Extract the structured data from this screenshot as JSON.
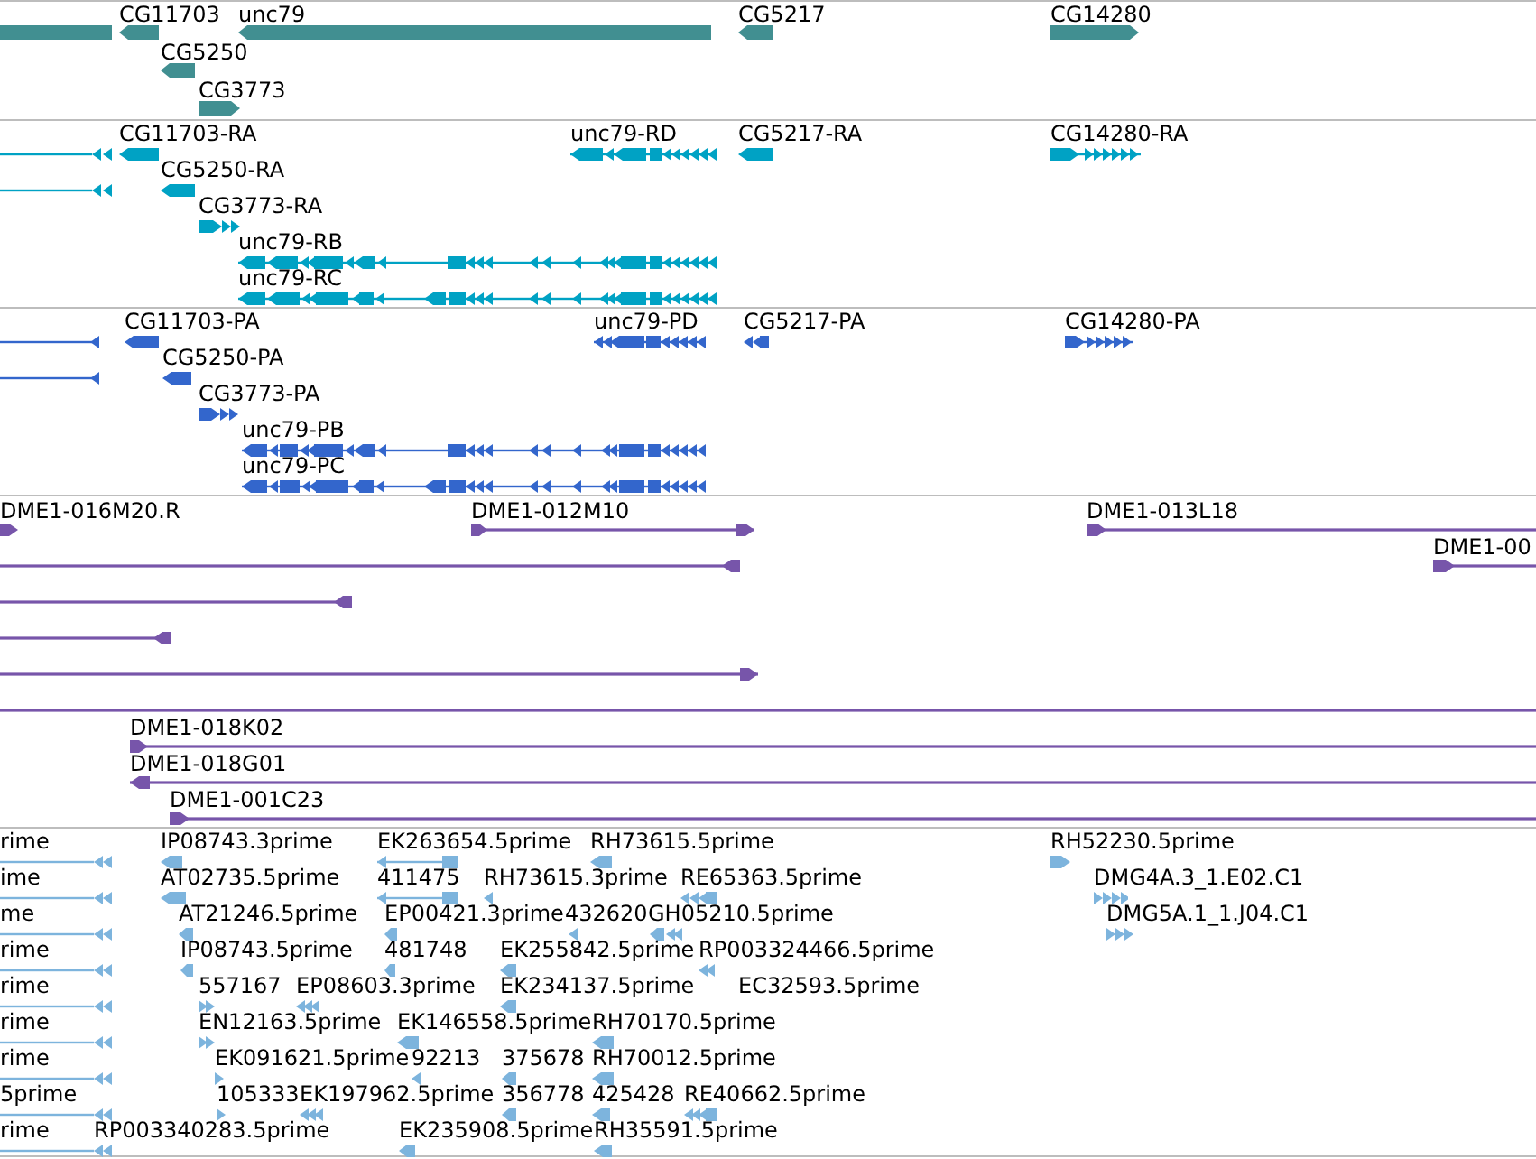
{
  "tracks": [
    {
      "kind": "gene",
      "features": [
        {
          "reverse": true
        },
        {
          "label": "CG11703",
          "reverse": true
        },
        {
          "label": "unc79",
          "reverse": true
        },
        {
          "label": "CG5217",
          "reverse": true
        },
        {
          "label": "CG14280",
          "reverse": false
        },
        {
          "label": "CG5250",
          "reverse": true
        },
        {
          "label": "CG3773",
          "reverse": false
        }
      ]
    },
    {
      "kind": "transcript",
      "features": [
        {
          "reverse": true
        },
        {
          "label": "CG11703-RA",
          "reverse": true
        },
        {
          "label": "unc79-RD",
          "reverse": true
        },
        {
          "label": "CG5217-RA",
          "reverse": true
        },
        {
          "label": "CG14280-RA",
          "reverse": false
        },
        {
          "reverse": true
        },
        {
          "label": "CG5250-RA",
          "reverse": true
        },
        {
          "label": "CG3773-RA",
          "reverse": false
        },
        {
          "label": "unc79-RB",
          "reverse": true
        },
        {
          "label": "unc79-RC",
          "reverse": true
        }
      ]
    },
    {
      "kind": "protein",
      "features": [
        {
          "reverse": true
        },
        {
          "label": "CG11703-PA",
          "reverse": true
        },
        {
          "label": "unc79-PD",
          "reverse": true
        },
        {
          "label": "CG5217-PA",
          "reverse": true
        },
        {
          "label": "CG14280-PA",
          "reverse": false
        },
        {
          "reverse": true
        },
        {
          "label": "CG5250-PA",
          "reverse": true
        },
        {
          "label": "CG3773-PA",
          "reverse": false
        },
        {
          "label": "unc79-PB",
          "reverse": true
        },
        {
          "label": "unc79-PC",
          "reverse": true
        }
      ]
    },
    {
      "kind": "clone",
      "features": [
        {
          "kind": "capped",
          "label": "DME1-016M20.R",
          "reverse": false
        },
        {
          "kind": "capped",
          "label": "DME1-012M10",
          "reverse": false
        },
        {
          "kind": "capped",
          "label": "DME1-013L18",
          "reverse": false
        },
        {
          "kind": "capped",
          "reverse": true
        },
        {
          "kind": "capped",
          "label": "DME1-00",
          "reverse": false
        },
        {
          "kind": "capped",
          "reverse": true
        },
        {
          "kind": "capped",
          "reverse": true
        },
        {
          "kind": "capped",
          "reverse": false
        },
        {
          "kind": "spanning"
        },
        {
          "kind": "capped",
          "label": "DME1-018K02",
          "reverse": false
        },
        {
          "kind": "capped",
          "label": "DME1-018G01",
          "reverse": true
        },
        {
          "kind": "capped",
          "label": "DME1-001C23",
          "reverse": false
        }
      ]
    },
    {
      "kind": "est",
      "features": [
        {
          "label": "rime",
          "reverse": true
        },
        {
          "label": "IP08743.3prime",
          "reverse": true
        },
        {
          "label": "EK263654.5prime",
          "reverse": true
        },
        {
          "label": "RH73615.5prime",
          "reverse": true
        },
        {
          "label": "RH52230.5prime",
          "reverse": false
        },
        {
          "label": "ime",
          "reverse": true
        },
        {
          "label": "AT02735.5prime",
          "reverse": true
        },
        {
          "label": "411475",
          "reverse": true
        },
        {
          "label": "RH73615.3prime",
          "reverse": true
        },
        {
          "label": "RE65363.5prime",
          "reverse": true
        },
        {
          "label": "DMG4A.3_1.E02.C1",
          "reverse": false
        },
        {
          "label": "me",
          "reverse": true
        },
        {
          "label": "AT21246.5prime",
          "reverse": true
        },
        {
          "label": "EP00421.3prime",
          "reverse": true
        },
        {
          "label": "432620",
          "reverse": true
        },
        {
          "label": "GH05210.5prime",
          "reverse": true
        },
        {
          "label": "DMG5A.1_1.J04.C1",
          "reverse": false
        },
        {
          "label": "rime",
          "reverse": true
        },
        {
          "label": "IP08743.5prime",
          "reverse": true
        },
        {
          "label": "481748",
          "reverse": true
        },
        {
          "label": "EK255842.5prime",
          "reverse": true
        },
        {
          "label": "RP003324466.5prime",
          "reverse": true
        },
        {
          "label": "rime",
          "reverse": true
        },
        {
          "label": "557167",
          "reverse": false
        },
        {
          "label": "EP08603.3prime",
          "reverse": true
        },
        {
          "label": "EK234137.5prime",
          "reverse": true
        },
        {
          "label": "EC32593.5prime"
        },
        {
          "label": "rime",
          "reverse": true
        },
        {
          "label": "EN12163.5prime",
          "reverse": false
        },
        {
          "label": "EK146558.5prime",
          "reverse": true
        },
        {
          "label": "RH70170.5prime",
          "reverse": true
        },
        {
          "label": "rime",
          "reverse": true
        },
        {
          "label": "EK091621.5prime",
          "reverse": false
        },
        {
          "label": "92213",
          "reverse": true
        },
        {
          "label": "375678",
          "reverse": true
        },
        {
          "label": "RH70012.5prime",
          "reverse": true
        },
        {
          "label": "5prime",
          "reverse": true
        },
        {
          "label": "105333",
          "reverse": false
        },
        {
          "label": "EK197962.5prime",
          "reverse": true
        },
        {
          "label": "356778",
          "reverse": true
        },
        {
          "label": "425428",
          "reverse": true
        },
        {
          "label": "RE40662.5prime",
          "reverse": true
        },
        {
          "label": "rime",
          "reverse": true
        },
        {
          "label": "RP003340283.5prime"
        },
        {
          "label": "EK235908.5prime",
          "reverse": true
        },
        {
          "label": "RH35591.5prime",
          "reverse": true
        }
      ]
    }
  ]
}
